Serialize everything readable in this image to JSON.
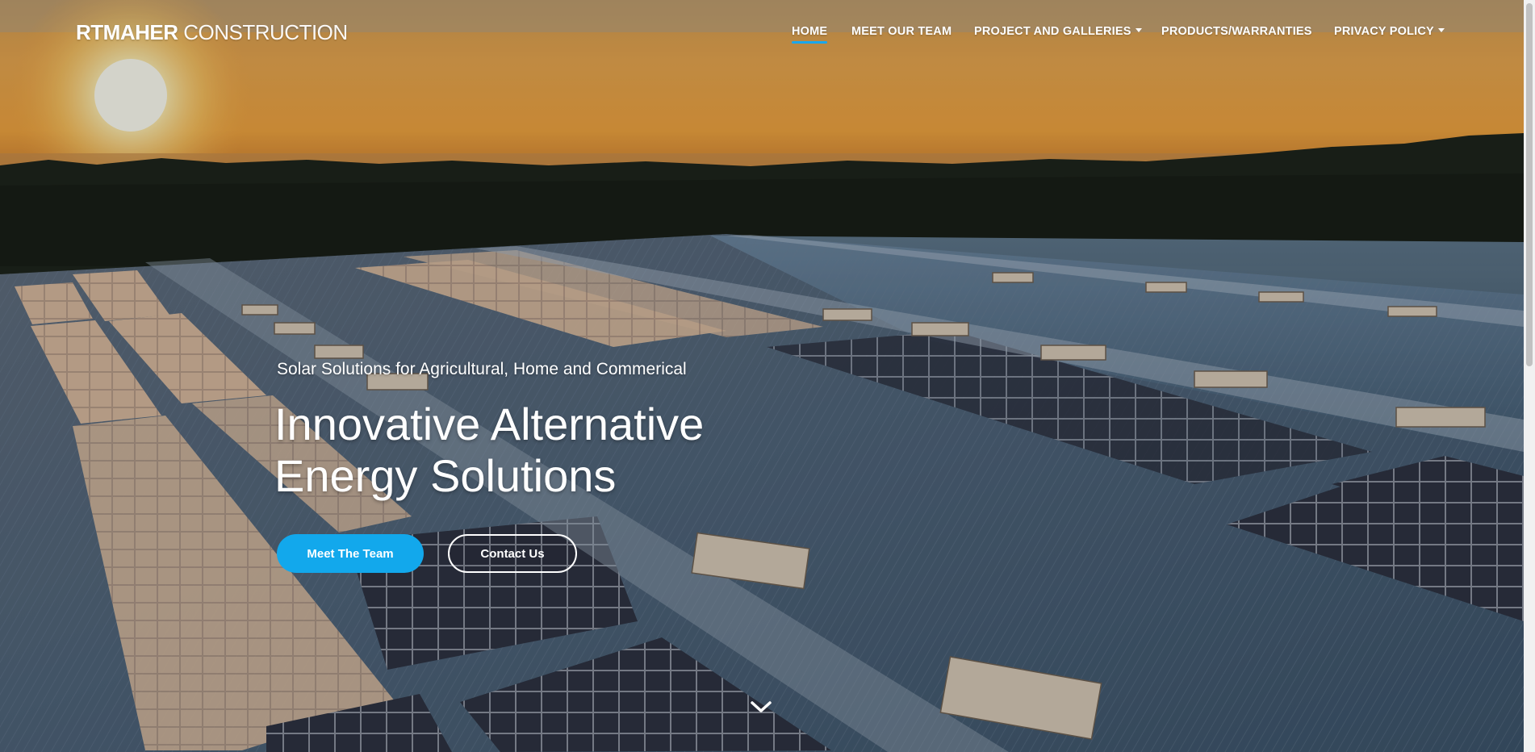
{
  "brand": {
    "bold": "RTMAHER",
    "light": "CONSTRUCTION"
  },
  "nav": {
    "items": [
      {
        "label": "HOME",
        "active": true
      },
      {
        "label": "MEET OUR TEAM"
      },
      {
        "label": "PROJECT AND GALLERIES",
        "dropdown": true
      },
      {
        "label": "PRODUCTS/WARRANTIES"
      },
      {
        "label": "PRIVACY POLICY",
        "dropdown": true
      }
    ]
  },
  "hero": {
    "tagline": "Solar Solutions for Agricultural, Home and Commerical",
    "headline_line1": "Innovative Alternative",
    "headline_line2": "Energy Solutions",
    "primary_button": "Meet The Team",
    "secondary_button": "Contact Us",
    "scroll_icon": "chevron-down-icon"
  },
  "colors": {
    "accent": "#12a8ec",
    "active_underline": "#1aa7ec",
    "text": "#ffffff"
  }
}
